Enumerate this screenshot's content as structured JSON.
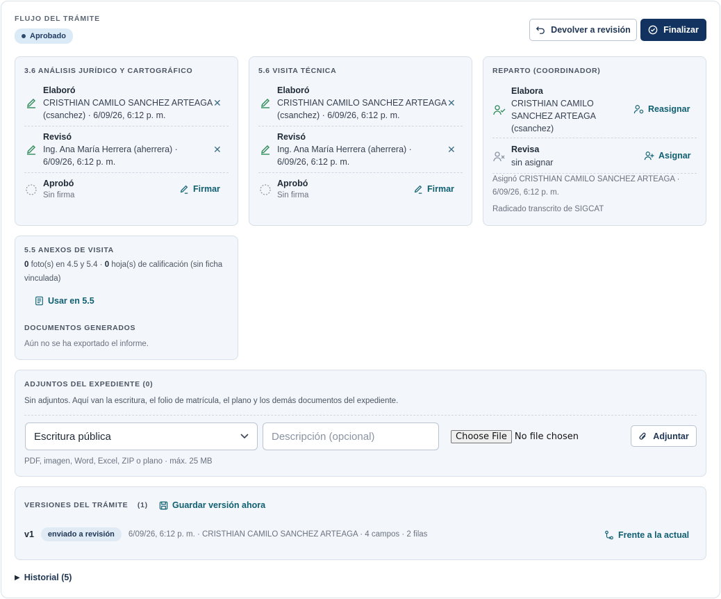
{
  "header": {
    "title": "FLUJO DEL TRÁMITE",
    "status": "Aprobado",
    "btn_return": "Devolver a revisión",
    "btn_finalize": "Finalizar"
  },
  "card_analisis": {
    "title": "3.6 ANÁLISIS JURÍDICO Y CARTOGRÁFICO",
    "elaboro_label": "Elaboró",
    "elaboro_l1": "CRISTHIAN CAMILO SANCHEZ ARTEAGA",
    "elaboro_l2": "(csanchez) · 6/09/26, 6:12 p. m.",
    "reviso_label": "Revisó",
    "reviso_l1": "Ing. Ana María Herrera (aherrera) ·",
    "reviso_l2": "6/09/26, 6:12 p. m.",
    "aprobo_label": "Aprobó",
    "aprobo_value": "Sin firma",
    "sign_label": "Firmar"
  },
  "card_visita": {
    "title": "5.6 VISITA TÉCNICA",
    "elaboro_label": "Elaboró",
    "elaboro_l1": "CRISTHIAN CAMILO SANCHEZ ARTEAGA",
    "elaboro_l2": "(csanchez) · 6/09/26, 6:12 p. m.",
    "reviso_label": "Revisó",
    "reviso_l1": "Ing. Ana María Herrera (aherrera) ·",
    "reviso_l2": "6/09/26, 6:12 p. m.",
    "aprobo_label": "Aprobó",
    "aprobo_value": "Sin firma",
    "sign_label": "Firmar"
  },
  "card_reparto": {
    "title": "REPARTO (COORDINADOR)",
    "elabora_label": "Elabora",
    "elabora_l1": "CRISTHIAN CAMILO",
    "elabora_l2": "SANCHEZ ARTEAGA",
    "elabora_l3": "(csanchez)",
    "reassign_label": "Reasignar",
    "revisa_label": "Revisa",
    "revisa_value": "sin asignar",
    "assign_label": "Asignar",
    "note_l1": "Asignó CRISTHIAN CAMILO SANCHEZ ARTEAGA ·",
    "note_l2": "6/09/26, 6:12 p. m.",
    "note_l3": "Radicado transcrito de SIGCAT"
  },
  "card_anexos": {
    "title": "5.5 ANEXOS DE VISITA",
    "photos_count": "0",
    "photos_text": " foto(s) en 4.5 y 5.4 · ",
    "sheets_count": "0",
    "sheets_text": " hoja(s) de calificación (sin ficha",
    "line2": "vinculada)",
    "use_label": "Usar en 5.5",
    "docs_title": "DOCUMENTOS GENERADOS",
    "docs_text": "Aún no se ha exportado el informe."
  },
  "adjuntos": {
    "title": "ADJUNTOS DEL EXPEDIENTE (0)",
    "desc": "Sin adjuntos. Aquí van la escritura, el folio de matrícula, el plano y los demás documentos del expediente.",
    "select_value": "Escritura pública",
    "description_placeholder": "Descripción (opcional)",
    "choose_file": "Choose File",
    "no_file": "No file chosen",
    "attach_label": "Adjuntar",
    "hint": "PDF, imagen, Word, Excel, ZIP o plano · máx. 25 MB"
  },
  "versiones": {
    "title": "VERSIONES DEL TRÁMITE",
    "count": "(1)",
    "save_label": "Guardar versión ahora",
    "row": {
      "version": "v1",
      "status": "enviado a revisión",
      "meta": "6/09/26, 6:12 p. m. · CRISTHIAN CAMILO SANCHEZ ARTEAGA · 4 campos · 2 filas",
      "compare_label": "Frente a la actual"
    }
  },
  "historial": {
    "label": "Historial (5)"
  },
  "colors": {
    "primary": "#12335f",
    "link": "#0f5f72",
    "card_bg": "#f3f6fa",
    "badge_bg": "#dbeaf7"
  }
}
